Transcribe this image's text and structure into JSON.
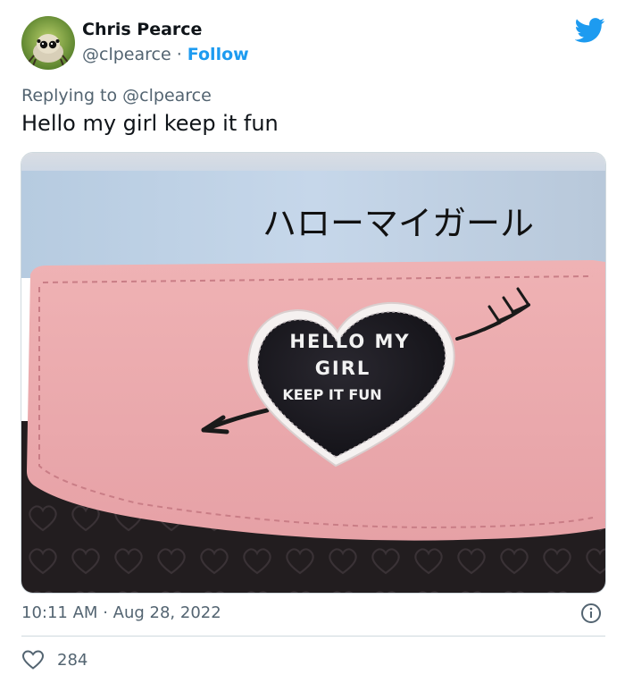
{
  "author": {
    "display_name": "Chris Pearce",
    "handle": "@clpearce",
    "separator": "·",
    "follow_label": "Follow",
    "avatar_icon": "jumping-spider-avatar"
  },
  "platform_icon": "twitter-bird-icon",
  "reply": {
    "prefix": "Replying to",
    "mention": "@clpearce"
  },
  "tweet": {
    "text": "Hello my girl keep it fun"
  },
  "media": {
    "japanese_text": "ハローマイガール",
    "patch_line1": "HELLO MY",
    "patch_line2": "GIRL",
    "patch_line3": "KEEP IT FUN"
  },
  "meta": {
    "time": "10:11 AM",
    "separator": "·",
    "date": "Aug 28, 2022",
    "info_icon": "info-icon"
  },
  "engagement": {
    "like_icon": "heart-icon",
    "like_count": "284"
  },
  "colors": {
    "accent": "#1d9bf0",
    "text": "#0f1419",
    "muted": "#536471",
    "border": "#cfd9de"
  }
}
